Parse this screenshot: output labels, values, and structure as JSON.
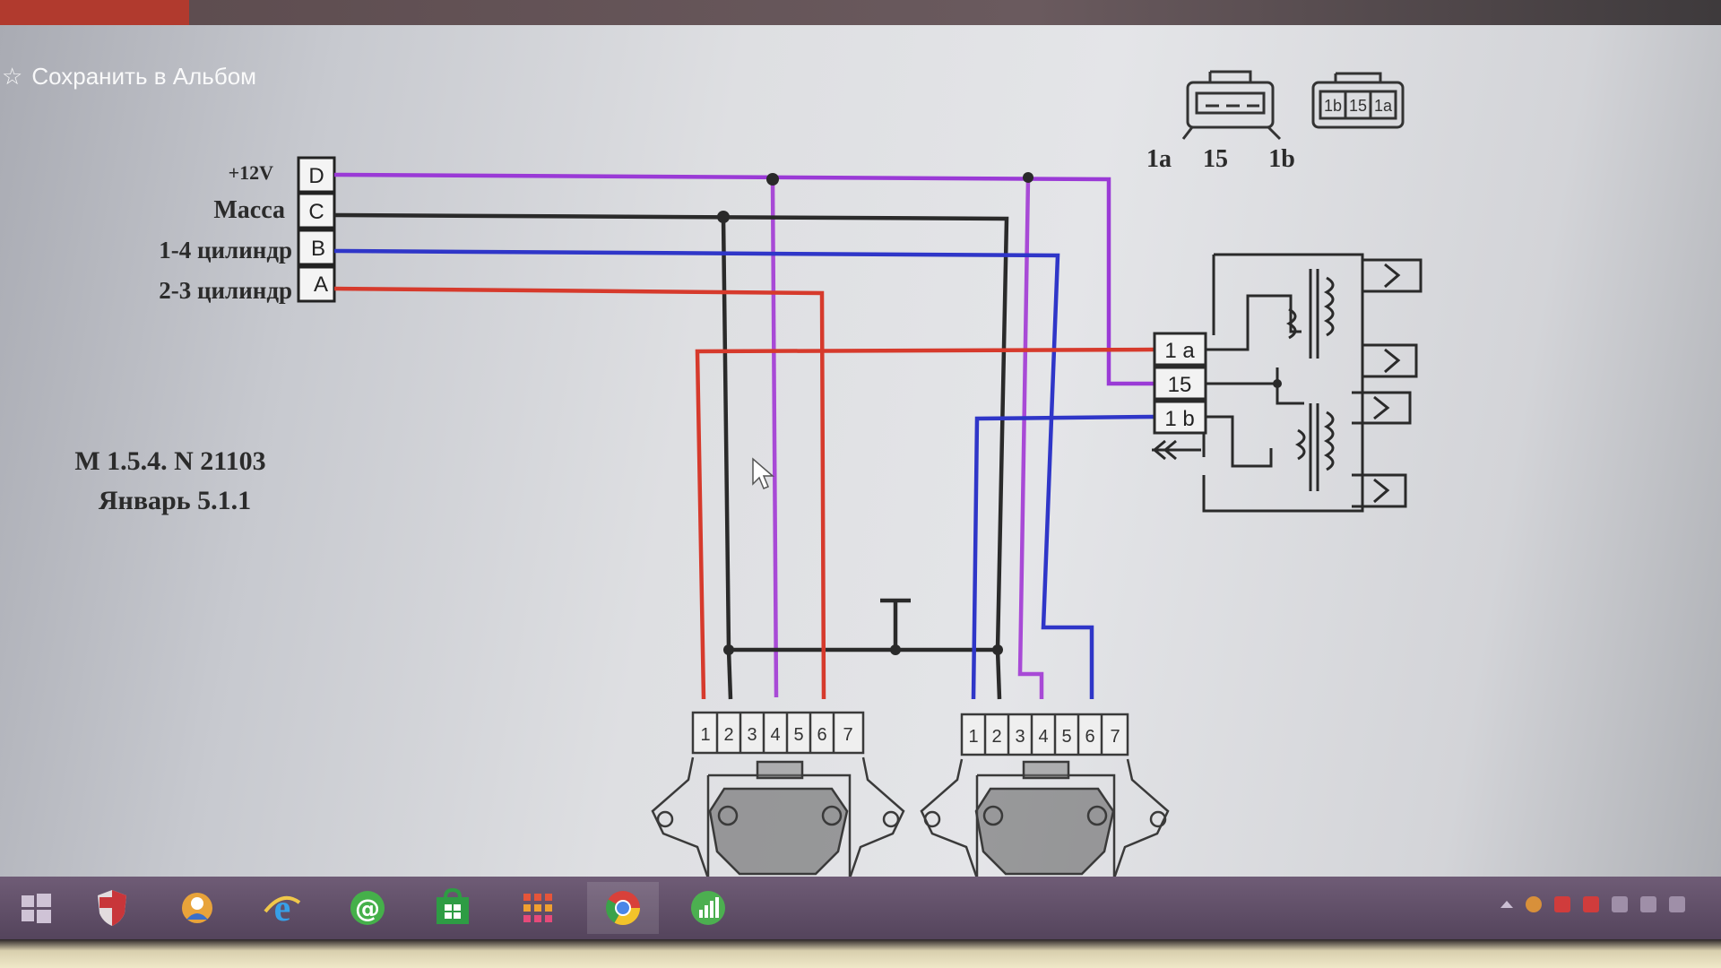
{
  "save_bar": {
    "label": "Сохранить в Альбом",
    "icon": "star-icon"
  },
  "diagram": {
    "connector_labels": {
      "plus12v": "+12V",
      "massa": "Масса",
      "cyl14": "1-4 цилиндр",
      "cyl23": "2-3 цилиндр"
    },
    "connector_pins": {
      "d": "D",
      "c": "C",
      "b": "B",
      "a": "A"
    },
    "title_line1": "М 1.5.4. N 21103",
    "title_line2": "Январь 5.1.1",
    "coil_pins": {
      "p1a": "1 a",
      "p15": "15",
      "p1b": "1 b"
    },
    "plug_side_labels": {
      "l1a": "1a",
      "l15": "15",
      "l1b": "1b"
    },
    "plug_face_labels": {
      "f1b": "1b",
      "f15": "15",
      "f1a": "1a"
    },
    "module_pin_numbers": [
      "1",
      "2",
      "3",
      "4",
      "5",
      "6",
      "7"
    ],
    "wire_colors": {
      "plus12v": "#9a3ad6",
      "massa": "#2a2a2a",
      "cyl14": "#2f36c8",
      "cyl23": "#d63a2c"
    }
  },
  "taskbar": {
    "icons": [
      "windows-start-icon",
      "shield-icon",
      "user-icon",
      "ie-browser-icon",
      "mail-agent-icon",
      "store-icon",
      "apps-grid-icon",
      "chrome-icon",
      "stats-icon"
    ]
  }
}
